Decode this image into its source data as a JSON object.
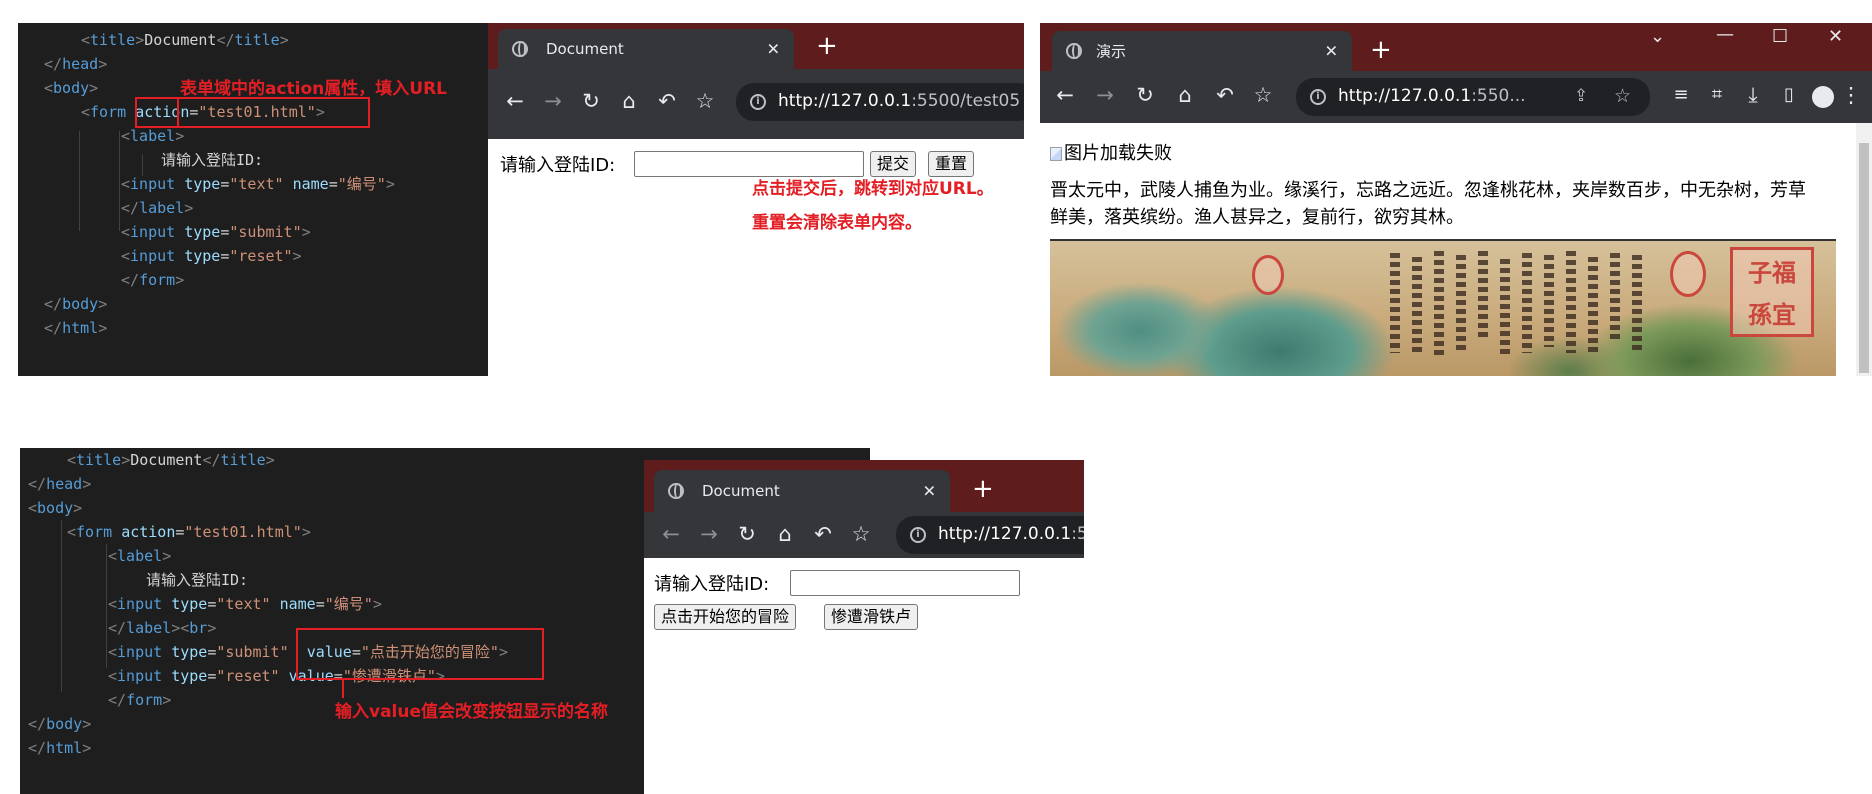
{
  "panel1": {
    "code": {
      "title_tag": "title",
      "title_text": "Document",
      "head_tag": "head",
      "body_tag": "body",
      "html_tag": "html",
      "form_tag": "form",
      "action_attr": "action",
      "action_value": "\"test01.html\"",
      "label_tag": "label",
      "label_text": "请输入登陆ID:",
      "input_tag": "input",
      "type_attr": "type",
      "name_attr": "name",
      "type_text": "\"text\"",
      "name_value": "\"编号\"",
      "type_submit": "\"submit\"",
      "type_reset": "\"reset\""
    },
    "annotation": "表单域中的action属性，填入URL",
    "browser": {
      "tab_title": "Document",
      "tab_close": "✕",
      "new_tab": "+",
      "url_host": "http://127.0.0.1",
      "url_rest": ":5500/test05",
      "label": "请输入登陆ID:",
      "submit_label": "提交",
      "reset_label": "重置"
    },
    "note_line1": "点击提交后，跳转到对应URL。",
    "note_line2": "重置会清除表单内容。"
  },
  "panel2": {
    "tab_title": "演示",
    "tab_close": "✕",
    "new_tab": "+",
    "url_host": "http://127.0.0.1",
    "url_rest": ":550...",
    "broken_image_alt": "图片加载失败",
    "paragraph": "晋太元中，武陵人捕鱼为业。缘溪行，忘路之远近。忽逢桃花林，夹岸数百步，中无杂树，芳草鲜美，落英缤纷。渔人甚异之，复前行，欲穷其林。",
    "window_controls": {
      "chevron": "⌄",
      "minimize": "—",
      "maximize": "☐",
      "close": "✕"
    },
    "seal_text": "子福孫宜"
  },
  "panel3": {
    "code": {
      "title_tag": "title",
      "title_text": "Document",
      "head_tag": "head",
      "body_tag": "body",
      "html_tag": "html",
      "form_tag": "form",
      "action_attr": "action",
      "action_value": "\"test01.html\"",
      "label_tag": "label",
      "label_text": "请输入登陆ID:",
      "input_tag": "input",
      "type_attr": "type",
      "name_attr": "name",
      "value_attr": "value",
      "type_text": "\"text\"",
      "name_value": "\"编号\"",
      "br_tag": "br",
      "type_submit": "\"submit\"",
      "submit_value": "\"点击开始您的冒险\"",
      "type_reset": "\"reset\"",
      "reset_value": "\"惨遭滑铁卢\""
    },
    "annotation": "输入value值会改变按钮显示的名称",
    "browser": {
      "tab_title": "Document",
      "tab_close": "✕",
      "new_tab": "+",
      "url_host": "http://127.0.0.1",
      "url_rest": ":5",
      "label": "请输入登陆ID:",
      "submit_label": "点击开始您的冒险",
      "reset_label": "惨遭滑铁卢"
    }
  },
  "icons": {
    "back": "back-arrow-icon",
    "forward": "forward-arrow-icon",
    "reload": "reload-icon",
    "home": "home-icon",
    "undo": "undo-icon",
    "star": "star-icon",
    "info": "info-icon",
    "globe": "globe-icon",
    "share": "share-icon",
    "media": "media-icon",
    "crop": "crop-icon",
    "download": "download-icon",
    "sidebar": "sidebar-icon",
    "profile": "profile-icon",
    "menu": "menu-icon"
  },
  "colors": {
    "annotation_red": "#e31e24",
    "editor_bg": "#1e1e1e",
    "browser_frame": "#5e1c1c",
    "toolbar": "#35363a"
  }
}
